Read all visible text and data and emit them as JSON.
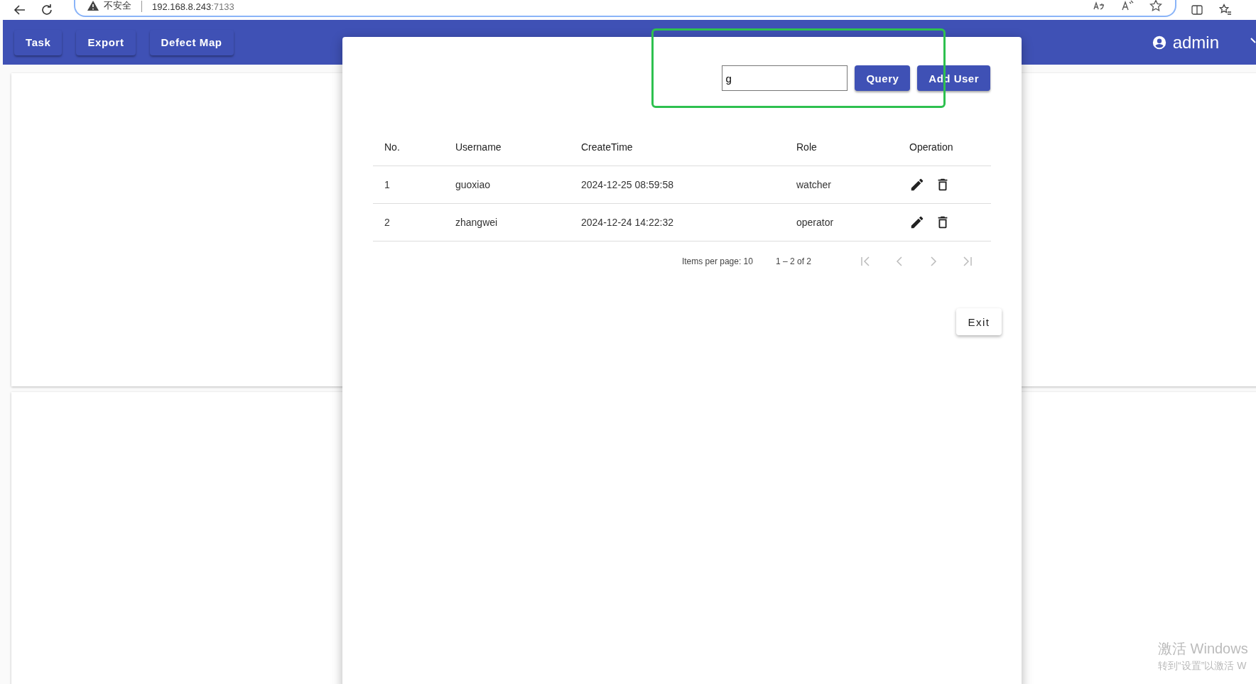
{
  "browser": {
    "security_label": "不安全",
    "url_host": "192.168.8.243",
    "url_port": ":7133"
  },
  "toolbar": {
    "buttons": [
      "Task",
      "Export",
      "Defect Map"
    ],
    "user": "admin"
  },
  "dialog": {
    "search": {
      "value": "g"
    },
    "buttons": [
      "Query",
      "Add User"
    ],
    "table": {
      "columns": [
        "No.",
        "Username",
        "CreateTime",
        "Role",
        "Operation"
      ],
      "rows": [
        {
          "cells": [
            "1",
            "guoxiao",
            "2024-12-25 08:59:58",
            "watcher"
          ]
        },
        {
          "cells": [
            "2",
            "zhangwei",
            "2024-12-24 14:22:32",
            "operator"
          ]
        }
      ]
    },
    "pagination": {
      "items_per_page_label": "Items per page:",
      "items_per_page": "10",
      "range": "1 – 2 of 2",
      "buttons": [
        {
          "kind": "first",
          "disabled": true
        },
        {
          "kind": "previous",
          "disabled": true
        },
        {
          "kind": "next",
          "disabled": true
        },
        {
          "kind": "last",
          "disabled": true
        }
      ]
    },
    "exit_button": "Exit"
  },
  "os_notice": {
    "title": "激活 Windows",
    "text": "转到“设置”以激活 W"
  }
}
